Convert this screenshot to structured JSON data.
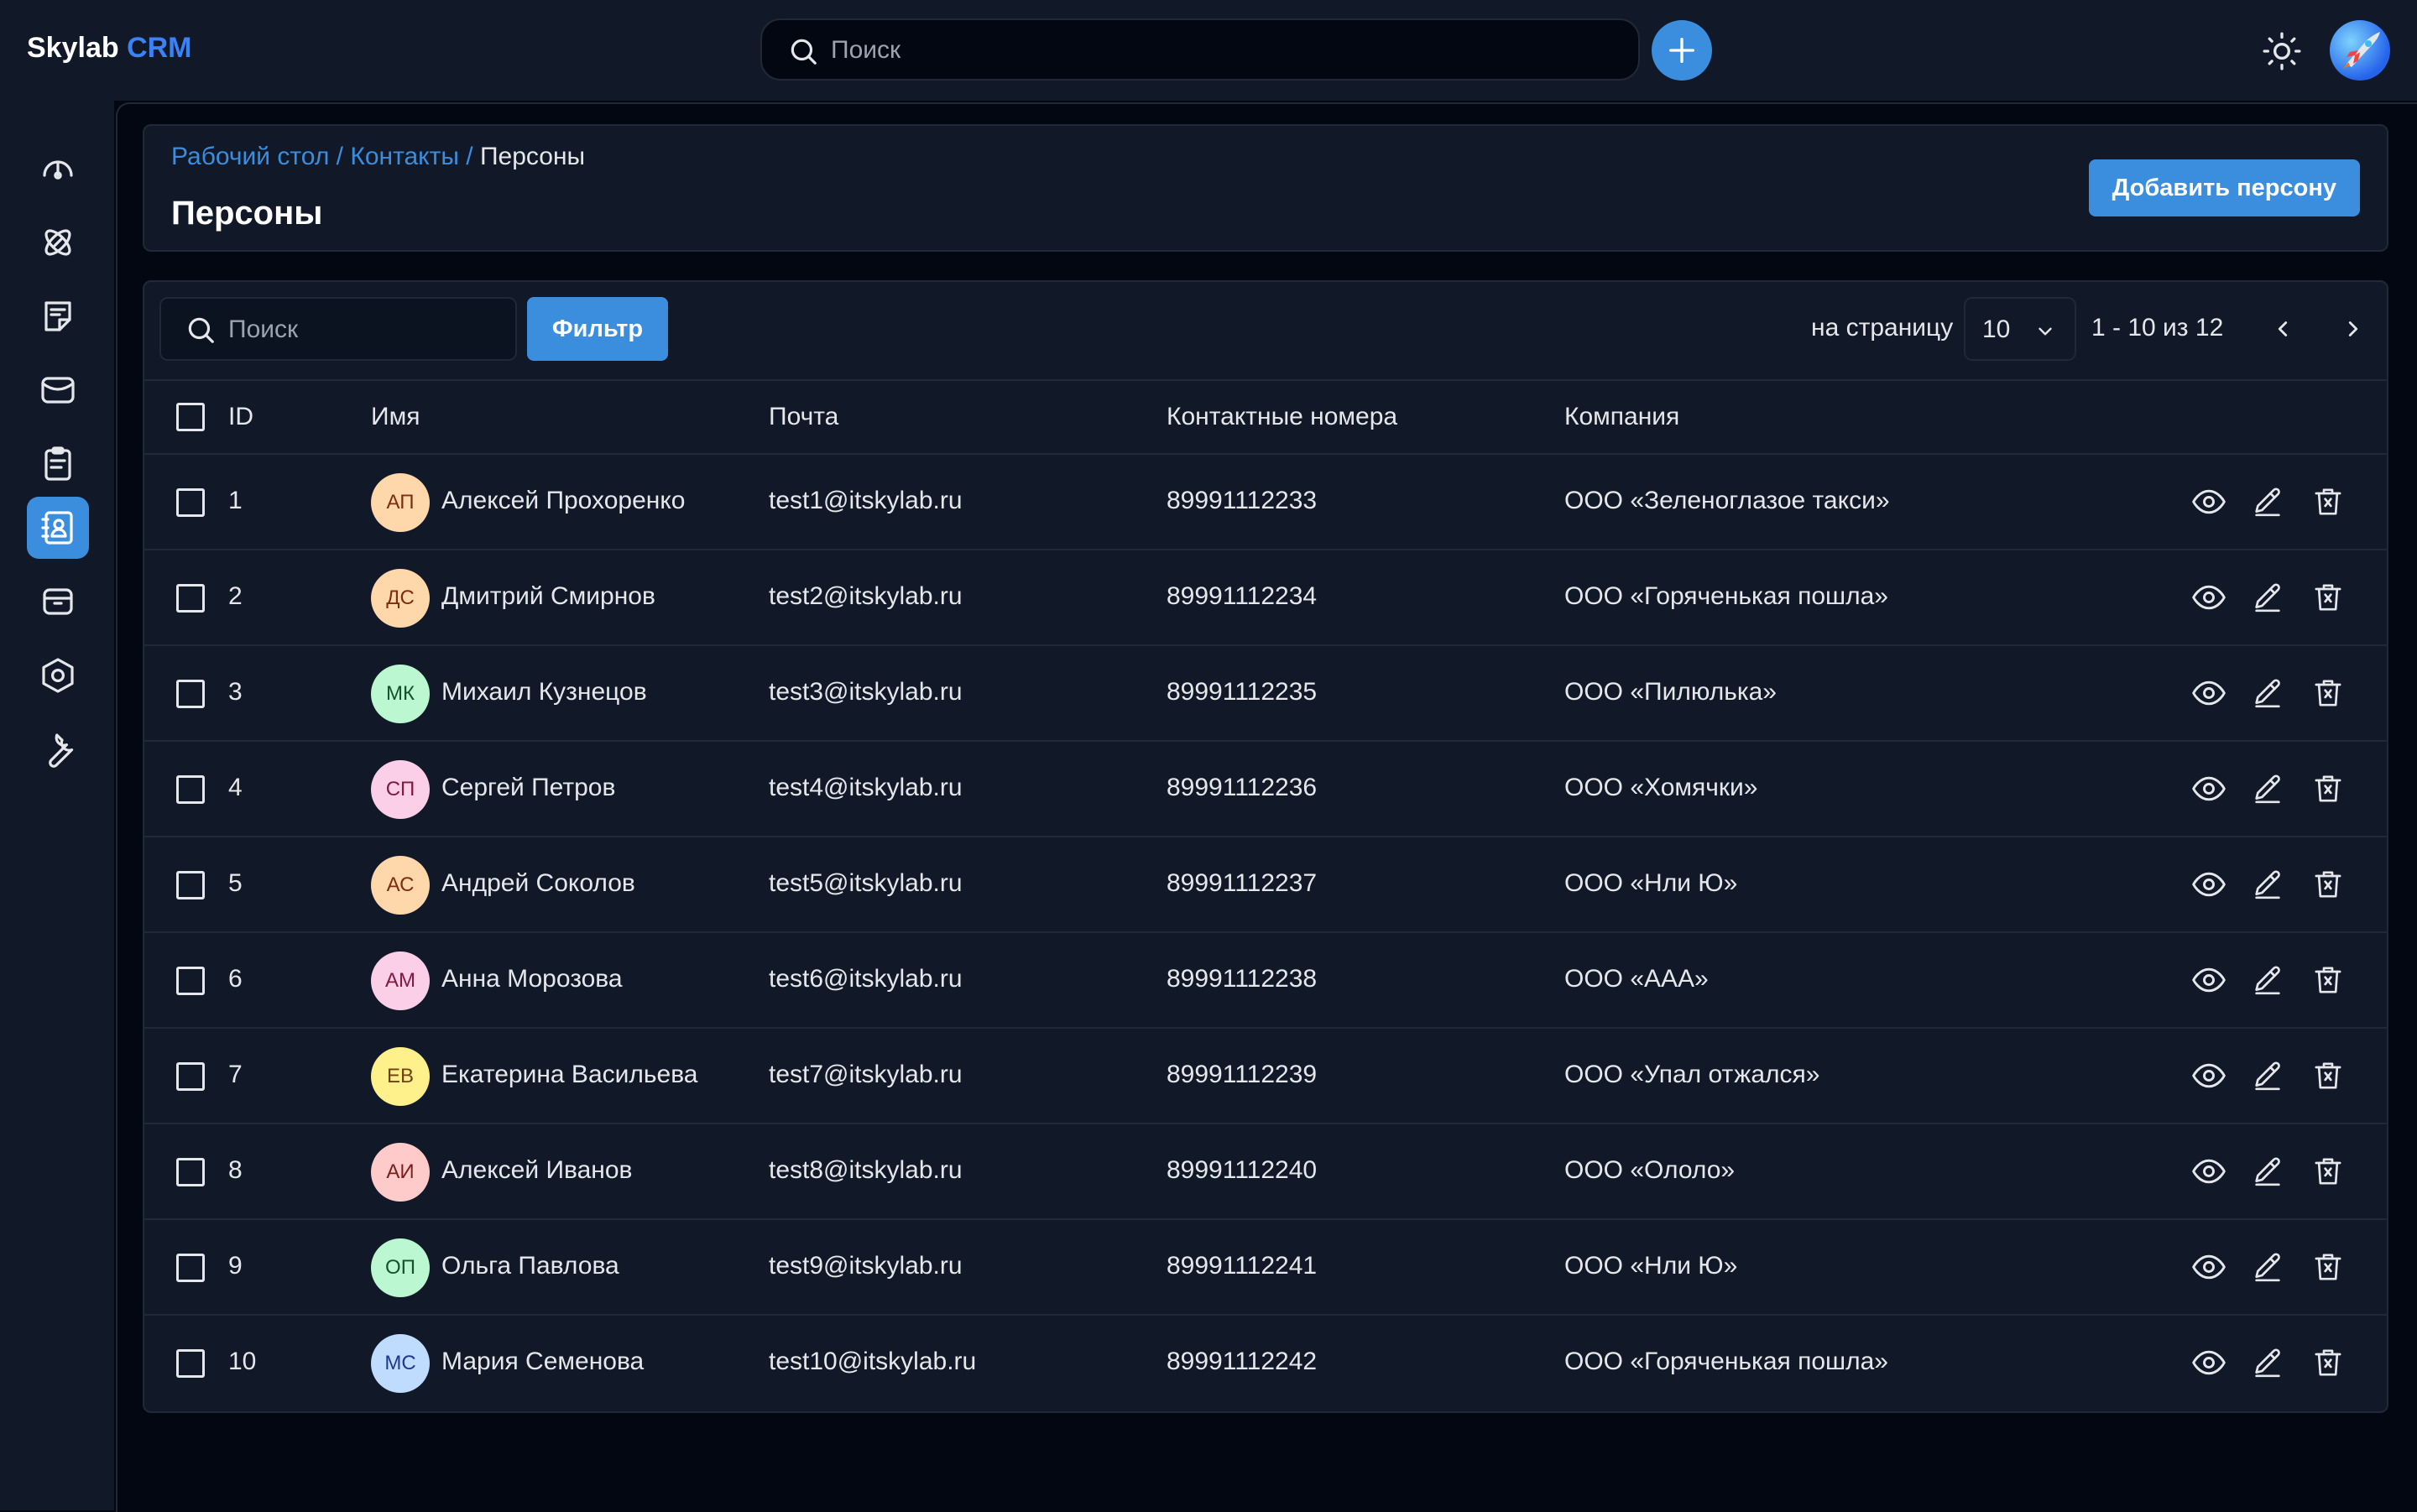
{
  "app": {
    "name_primary": "Skylab",
    "name_accent": "CRM"
  },
  "header": {
    "search_placeholder": "Поиск",
    "add_icon": "plus-icon",
    "theme_icon": "sun-icon",
    "avatar_icon": "user-avatar"
  },
  "colors": {
    "accent": "#3b8ede",
    "background": "#030712",
    "surface": "#111827",
    "border": "#1f2937"
  },
  "sidebar": {
    "items": [
      {
        "icon": "dashboard-gauge-icon",
        "active": false
      },
      {
        "icon": "deals-atom-icon",
        "active": false
      },
      {
        "icon": "notes-icon",
        "active": false
      },
      {
        "icon": "inbox-icon",
        "active": false
      },
      {
        "icon": "tasks-clipboard-icon",
        "active": false
      },
      {
        "icon": "contacts-book-icon",
        "active": true
      },
      {
        "icon": "archive-icon",
        "active": false
      },
      {
        "icon": "settings-hexagon-icon",
        "active": false
      },
      {
        "icon": "tools-wrench-icon",
        "active": false
      }
    ]
  },
  "page": {
    "breadcrumb": {
      "home": "Рабочий стол",
      "section": "Контакты",
      "current": "Персоны",
      "separator": "/"
    },
    "title": "Персоны",
    "add_button": "Добавить персону"
  },
  "toolbar": {
    "search_placeholder": "Поиск",
    "filter_button": "Фильтр",
    "per_page_label": "на страницу",
    "per_page_value": "10",
    "range_text": "1 - 10 из 12"
  },
  "table": {
    "columns": {
      "id": "ID",
      "name": "Имя",
      "email": "Почта",
      "phone": "Контактные номера",
      "company": "Компания"
    },
    "rows": [
      {
        "id": "1",
        "initials": "АП",
        "name": "Алексей Прохоренко",
        "email": "test1@itskylab.ru",
        "phone": "89991112233",
        "company": "ООО «Зеленоглазое такси»",
        "avatar_bg": "#fed7aa",
        "avatar_fg": "#7c2d12"
      },
      {
        "id": "2",
        "initials": "ДС",
        "name": "Дмитрий Смирнов",
        "email": "test2@itskylab.ru",
        "phone": "89991112234",
        "company": "ООО «Горяченькая пошла»",
        "avatar_bg": "#fed7aa",
        "avatar_fg": "#7c2d12"
      },
      {
        "id": "3",
        "initials": "МК",
        "name": "Михаил Кузнецов",
        "email": "test3@itskylab.ru",
        "phone": "89991112235",
        "company": "ООО «Пилюлька»",
        "avatar_bg": "#bbf7d0",
        "avatar_fg": "#14532d"
      },
      {
        "id": "4",
        "initials": "СП",
        "name": "Сергей Петров",
        "email": "test4@itskylab.ru",
        "phone": "89991112236",
        "company": "ООО «Хомячки»",
        "avatar_bg": "#fbcfe8",
        "avatar_fg": "#831843"
      },
      {
        "id": "5",
        "initials": "АС",
        "name": "Андрей Соколов",
        "email": "test5@itskylab.ru",
        "phone": "89991112237",
        "company": "ООО «Нли Ю»",
        "avatar_bg": "#fed7aa",
        "avatar_fg": "#7c2d12"
      },
      {
        "id": "6",
        "initials": "АМ",
        "name": "Анна Морозова",
        "email": "test6@itskylab.ru",
        "phone": "89991112238",
        "company": "ООО «ААА»",
        "avatar_bg": "#fbcfe8",
        "avatar_fg": "#831843"
      },
      {
        "id": "7",
        "initials": "ЕВ",
        "name": "Екатерина Васильева",
        "email": "test7@itskylab.ru",
        "phone": "89991112239",
        "company": "ООО «Упал отжался»",
        "avatar_bg": "#fef08a",
        "avatar_fg": "#713f12"
      },
      {
        "id": "8",
        "initials": "АИ",
        "name": "Алексей Иванов",
        "email": "test8@itskylab.ru",
        "phone": "89991112240",
        "company": "ООО «Ололо»",
        "avatar_bg": "#fecaca",
        "avatar_fg": "#7f1d1d"
      },
      {
        "id": "9",
        "initials": "ОП",
        "name": "Ольга Павлова",
        "email": "test9@itskylab.ru",
        "phone": "89991112241",
        "company": "ООО «Нли Ю»",
        "avatar_bg": "#bbf7d0",
        "avatar_fg": "#14532d"
      },
      {
        "id": "10",
        "initials": "МС",
        "name": "Мария Семенова",
        "email": "test10@itskylab.ru",
        "phone": "89991112242",
        "company": "ООО «Горяченькая пошла»",
        "avatar_bg": "#bfdbfe",
        "avatar_fg": "#1e3a8a"
      }
    ],
    "row_actions": [
      "view-eye-icon",
      "edit-pencil-icon",
      "delete-trash-icon"
    ]
  }
}
